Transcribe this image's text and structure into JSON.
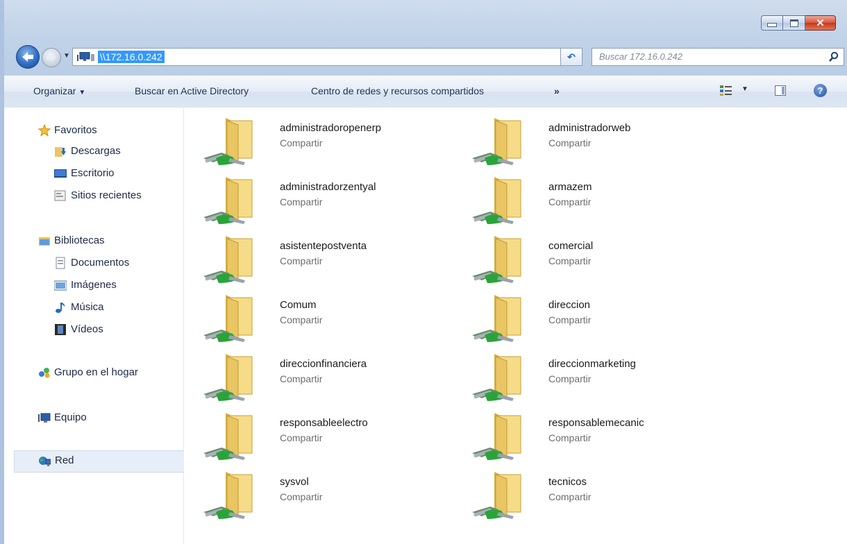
{
  "address": {
    "path": "\\\\172.16.0.242"
  },
  "search": {
    "placeholder": "Buscar 172.16.0.242"
  },
  "toolbar": {
    "organize": "Organizar",
    "active_directory": "Buscar en Active Directory",
    "network_center": "Centro de redes y recursos compartidos",
    "more": "»"
  },
  "sidebar": {
    "favorites": {
      "label": "Favoritos",
      "items": [
        "Descargas",
        "Escritorio",
        "Sitios recientes"
      ]
    },
    "libraries": {
      "label": "Bibliotecas",
      "items": [
        "Documentos",
        "Imágenes",
        "Música",
        "Vídeos"
      ]
    },
    "homegroup": "Grupo en el hogar",
    "computer": "Equipo",
    "network": "Red"
  },
  "shares": [
    {
      "name": "administradoropenerp",
      "type": "Compartir"
    },
    {
      "name": "administradorweb",
      "type": "Compartir"
    },
    {
      "name": "administradorzentyal",
      "type": "Compartir"
    },
    {
      "name": "armazem",
      "type": "Compartir"
    },
    {
      "name": "asistentepostventa",
      "type": "Compartir"
    },
    {
      "name": "comercial",
      "type": "Compartir"
    },
    {
      "name": "Comum",
      "type": "Compartir"
    },
    {
      "name": "direccion",
      "type": "Compartir"
    },
    {
      "name": "direccionfinanciera",
      "type": "Compartir"
    },
    {
      "name": "direccionmarketing",
      "type": "Compartir"
    },
    {
      "name": "responsableelectro",
      "type": "Compartir"
    },
    {
      "name": "responsablemecanic",
      "type": "Compartir"
    },
    {
      "name": "sysvol",
      "type": "Compartir"
    },
    {
      "name": "tecnicos",
      "type": "Compartir"
    }
  ]
}
